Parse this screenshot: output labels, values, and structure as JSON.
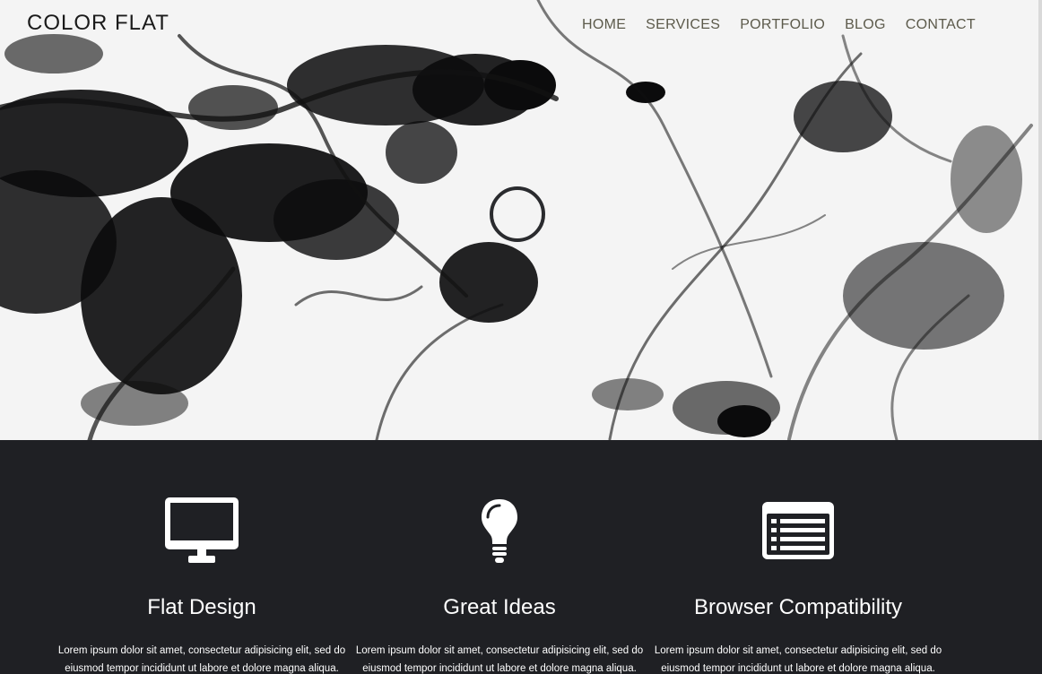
{
  "header": {
    "logo": "COLOR FLAT",
    "nav": [
      "HOME",
      "SERVICES",
      "PORTFOLIO",
      "BLOG",
      "CONTACT"
    ]
  },
  "features": [
    {
      "icon": "monitor-icon",
      "title": "Flat Design",
      "text": "Lorem ipsum dolor sit amet, consectetur adipisicing elit, sed do eiusmod tempor incididunt ut labore et dolore magna aliqua."
    },
    {
      "icon": "lightbulb-icon",
      "title": "Great Ideas",
      "text": "Lorem ipsum dolor sit amet, consectetur adipisicing elit, sed do eiusmod tempor incididunt ut labore et dolore magna aliqua."
    },
    {
      "icon": "list-icon",
      "title": "Browser Compatibility",
      "text": "Lorem ipsum dolor sit amet, consectetur adipisicing elit, sed do eiusmod tempor incididunt ut labore et dolore magna aliqua."
    }
  ],
  "colors": {
    "dark_background": "#1f2024",
    "nav_text": "#5c5a4b",
    "hero_background": "#f4f4f4"
  }
}
